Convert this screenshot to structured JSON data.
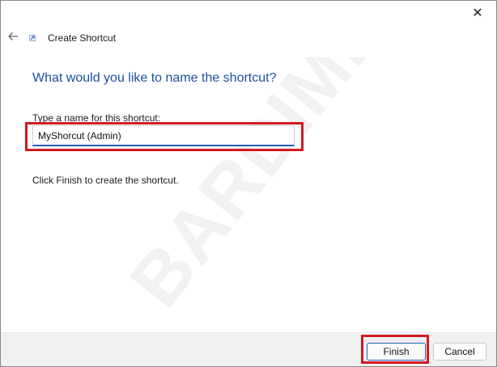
{
  "window": {
    "title": "Create Shortcut",
    "close_glyph": "✕",
    "back_icon": "back-arrow-icon",
    "app_icon": "shortcut-icon"
  },
  "main": {
    "heading": "What would you like to name the shortcut?",
    "field_label": "Type a name for this shortcut:",
    "name_value": "MyShorcut (Admin)",
    "hint": "Click Finish to create the shortcut."
  },
  "footer": {
    "finish_label": "Finish",
    "cancel_label": "Cancel"
  },
  "watermark": {
    "text": "BARDIMIN"
  },
  "colors": {
    "accent": "#1d4fa0",
    "highlight": "#d11a22",
    "footer_bg": "#f0f0f0"
  }
}
